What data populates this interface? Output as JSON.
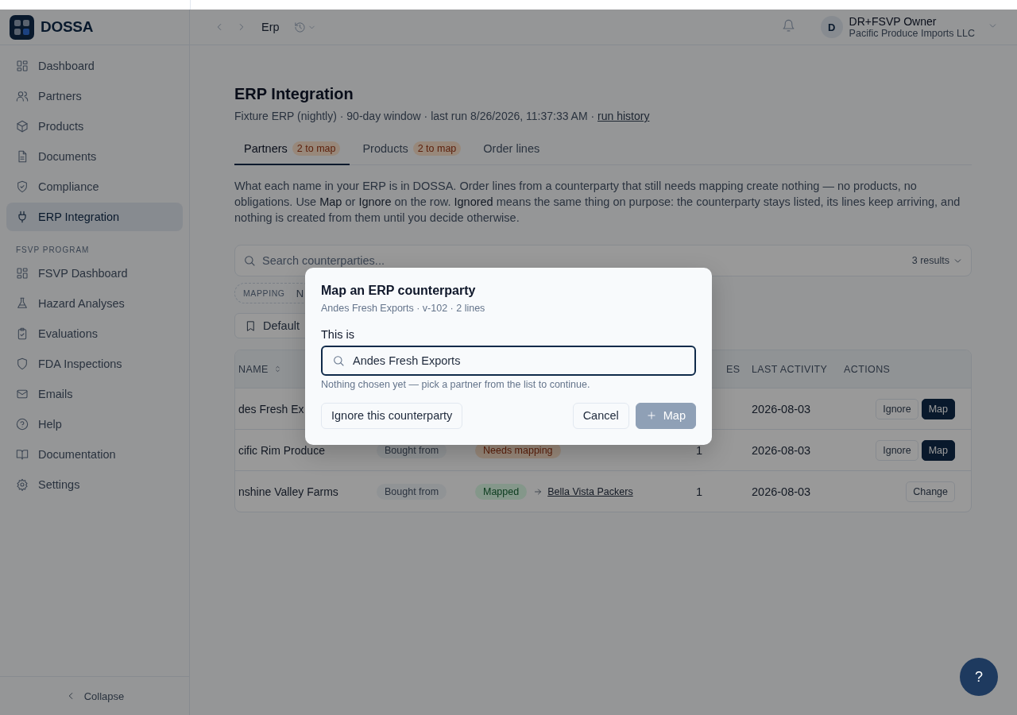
{
  "sidebar": {
    "logo": "DOSSA",
    "main_items": [
      {
        "label": "Dashboard",
        "selected": false
      },
      {
        "label": "Partners",
        "selected": false
      },
      {
        "label": "Products",
        "selected": false
      },
      {
        "label": "Documents",
        "selected": false
      },
      {
        "label": "Compliance",
        "selected": false
      },
      {
        "label": "ERP Integration",
        "selected": true
      }
    ],
    "section": {
      "heading": "FSVP PROGRAM",
      "items": [
        {
          "label": "FSVP Dashboard",
          "selected": false
        },
        {
          "label": "Hazard Analyses",
          "selected": false
        },
        {
          "label": "Evaluations",
          "selected": false
        },
        {
          "label": "FDA Inspections",
          "selected": false
        },
        {
          "label": "Emails",
          "selected": false
        },
        {
          "label": "Help",
          "selected": false
        },
        {
          "label": "Documentation",
          "selected": false
        },
        {
          "label": "Settings",
          "selected": false
        }
      ]
    },
    "collapse": "Collapse"
  },
  "header": {
    "breadcrumb": "Erp",
    "user": {
      "initial": "D",
      "name": "DR+FSVP Owner",
      "org": "Pacific Produce Imports LLC"
    }
  },
  "page": {
    "title": "ERP Integration",
    "subtitle": "Fixture ERP (nightly) · 90-day window · last run 8/26/2026, 11:37:33 AM ·",
    "subtitle_link": "run history",
    "tabs": [
      {
        "label": "Partners",
        "badge": "2 to map",
        "selected": true
      },
      {
        "label": "Products",
        "badge": "2 to map",
        "selected": false
      },
      {
        "label": "Order lines",
        "selected": false
      }
    ],
    "description": "What each name in your ERP is in DOSSA. Order lines from a counterparty that still needs mapping create nothing — no products, no obligations. Use **Map** or **Ignore** on the row. **Ignored** means the same thing on purpose: the counterparty stays listed, its lines keep arriving, and nothing is created from them until you decide otherwise.",
    "search": {
      "placeholder": "Search counterparties...",
      "results": "3 results"
    },
    "filter": {
      "label": "MAPPING",
      "value": "N"
    },
    "view_button": "Default",
    "table": {
      "columns": {
        "name": "NAME",
        "lines": "ES",
        "last_activity": "LAST ACTIVITY",
        "actions": "ACTIONS"
      },
      "rows": [
        {
          "name": "des Fresh Ex",
          "last_activity": "2026-08-03",
          "actions": [
            {
              "label": "Ignore",
              "kind": "secondary"
            },
            {
              "label": "Map",
              "kind": "primary"
            }
          ]
        },
        {
          "name": "cific Rim Produce",
          "type": "Bought from",
          "status": {
            "label": "Needs mapping",
            "kind": "needs_mapping"
          },
          "lines": "1",
          "last_activity": "2026-08-03",
          "actions": [
            {
              "label": "Ignore",
              "kind": "secondary"
            },
            {
              "label": "Map",
              "kind": "primary"
            }
          ]
        },
        {
          "name": "nshine Valley Farms",
          "type": "Bought from",
          "status": {
            "label": "Mapped",
            "kind": "mapped"
          },
          "mapped_to": "Bella Vista Packers",
          "lines": "1",
          "last_activity": "2026-08-03",
          "actions": [
            {
              "label": "Change",
              "kind": "secondary"
            }
          ]
        }
      ]
    }
  },
  "dialog": {
    "title": "Map an ERP counterparty",
    "subtitle": "Andes Fresh Exports · v-102 · 2 lines",
    "field_label": "This is",
    "field_value": "Andes Fresh Exports",
    "hint": "Nothing chosen yet — pick a partner from the list to continue.",
    "ignore_button": "Ignore this counterparty",
    "cancel_button": "Cancel",
    "map_button": {
      "label": "Map",
      "disabled": true
    }
  },
  "help_button": "?"
}
